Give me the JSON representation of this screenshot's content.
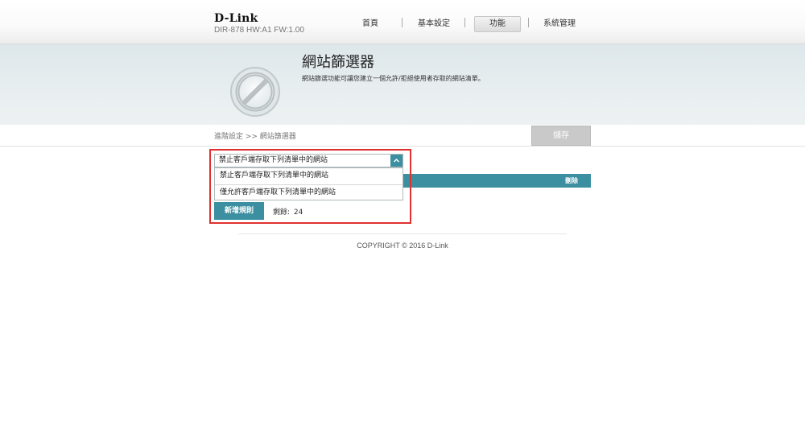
{
  "header": {
    "brand": "D-Link",
    "model": "DIR-878 HW:A1 FW:1.00",
    "nav": [
      "首頁",
      "基本設定",
      "功能",
      "系統管理"
    ],
    "active_nav": "功能"
  },
  "banner": {
    "title": "網站篩選器",
    "description": "網站篩選功能可讓您建立一個允許/拒絕使用者存取的網站清單。"
  },
  "breadcrumb": "進階設定 >> 網站篩選器",
  "toolbar": {
    "save_label": "儲存"
  },
  "filter": {
    "selected": "禁止客戶端存取下列清單中的網站",
    "options": [
      "禁止客戶端存取下列清單中的網站",
      "僅允許客戶端存取下列清單中的網站"
    ]
  },
  "table": {
    "delete_header": "刪除"
  },
  "rules": {
    "add_label": "新增規則",
    "remaining_label": "剩餘:",
    "remaining_count": "24"
  },
  "footer": {
    "copyright": "COPYRIGHT © 2016 D-Link"
  },
  "colors": {
    "accent": "#3b8fa0",
    "highlight": "#e0312f",
    "save_disabled": "#c9c9c9"
  },
  "icons": [
    "filter-prohibit-icon",
    "chevron-up-icon"
  ]
}
